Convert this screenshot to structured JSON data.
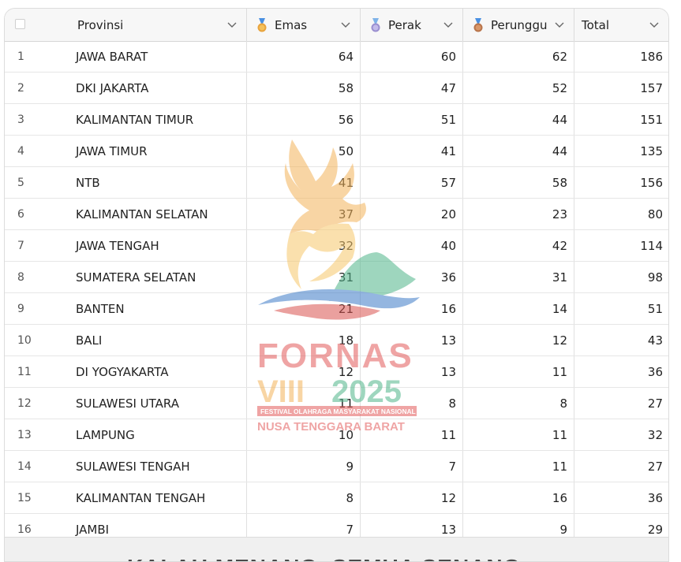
{
  "columns": {
    "provinsi": "Provinsi",
    "emas": "Emas",
    "perak": "Perak",
    "perunggu": "Perunggu",
    "total": "Total"
  },
  "medal_colors": {
    "gold": "#e8a33d",
    "silver": "#9a8fd0",
    "bronze": "#b8744a"
  },
  "rows": [
    {
      "no": "1",
      "provinsi": "JAWA BARAT",
      "emas": "64",
      "perak": "60",
      "perunggu": "62",
      "total": "186"
    },
    {
      "no": "2",
      "provinsi": "DKI JAKARTA",
      "emas": "58",
      "perak": "47",
      "perunggu": "52",
      "total": "157"
    },
    {
      "no": "3",
      "provinsi": "KALIMANTAN TIMUR",
      "emas": "56",
      "perak": "51",
      "perunggu": "44",
      "total": "151"
    },
    {
      "no": "4",
      "provinsi": "JAWA TIMUR",
      "emas": "50",
      "perak": "41",
      "perunggu": "44",
      "total": "135"
    },
    {
      "no": "5",
      "provinsi": "NTB",
      "emas": "41",
      "perak": "57",
      "perunggu": "58",
      "total": "156"
    },
    {
      "no": "6",
      "provinsi": "KALIMANTAN SELATAN",
      "emas": "37",
      "perak": "20",
      "perunggu": "23",
      "total": "80"
    },
    {
      "no": "7",
      "provinsi": "JAWA TENGAH",
      "emas": "32",
      "perak": "40",
      "perunggu": "42",
      "total": "114"
    },
    {
      "no": "8",
      "provinsi": "SUMATERA SELATAN",
      "emas": "31",
      "perak": "36",
      "perunggu": "31",
      "total": "98"
    },
    {
      "no": "9",
      "provinsi": "BANTEN",
      "emas": "21",
      "perak": "16",
      "perunggu": "14",
      "total": "51"
    },
    {
      "no": "10",
      "provinsi": "BALI",
      "emas": "18",
      "perak": "13",
      "perunggu": "12",
      "total": "43"
    },
    {
      "no": "11",
      "provinsi": "DI YOGYAKARTA",
      "emas": "12",
      "perak": "13",
      "perunggu": "11",
      "total": "36"
    },
    {
      "no": "12",
      "provinsi": "SULAWESI UTARA",
      "emas": "11",
      "perak": "8",
      "perunggu": "8",
      "total": "27"
    },
    {
      "no": "13",
      "provinsi": "LAMPUNG",
      "emas": "10",
      "perak": "11",
      "perunggu": "11",
      "total": "32"
    },
    {
      "no": "14",
      "provinsi": "SULAWESI TENGAH",
      "emas": "9",
      "perak": "7",
      "perunggu": "11",
      "total": "27"
    },
    {
      "no": "15",
      "provinsi": "KALIMANTAN TENGAH",
      "emas": "8",
      "perak": "12",
      "perunggu": "16",
      "total": "36"
    },
    {
      "no": "16",
      "provinsi": "JAMBI",
      "emas": "7",
      "perak": "13",
      "perunggu": "9",
      "total": "29"
    }
  ],
  "watermark": {
    "line1": "FORNAS",
    "line2a": "VIII",
    "line2b": "2025",
    "tagline": "FESTIVAL OLAHRAGA MASYARAKAT NASIONAL",
    "region": "NUSA TENGGARA BARAT"
  },
  "footer": {
    "text": "KALAU MENANG, SEMUA SENANG"
  }
}
